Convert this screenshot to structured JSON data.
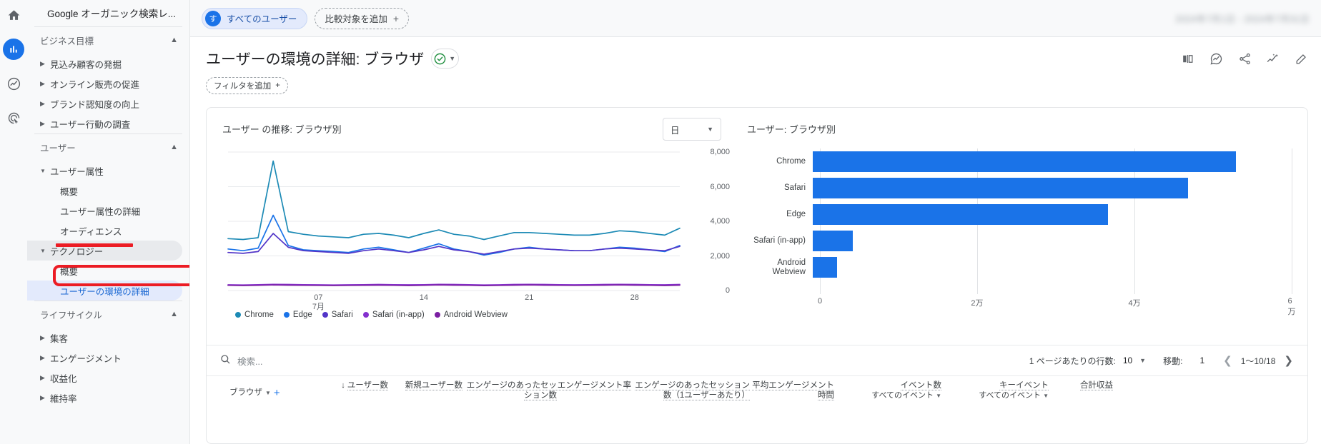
{
  "rail": {
    "items": [
      {
        "name": "home-icon",
        "label": "ホーム"
      },
      {
        "name": "reports-icon",
        "label": "レポート"
      },
      {
        "name": "explore-icon",
        "label": "探索"
      },
      {
        "name": "advertising-icon",
        "label": "広告"
      }
    ]
  },
  "sidebar": {
    "property_title": "Google オーガニック検索レ...",
    "groups": {
      "business": "ビジネス目標",
      "user": "ユーザー",
      "lifecycle": "ライフサイクル"
    },
    "items": [
      {
        "label": "見込み顧客の発掘",
        "marker": "collapsed"
      },
      {
        "label": "オンライン販売の促進",
        "marker": "collapsed"
      },
      {
        "label": "ブランド認知度の向上",
        "marker": "collapsed"
      },
      {
        "label": "ユーザー行動の調査",
        "marker": "collapsed"
      },
      {
        "label": "ユーザー属性",
        "marker": "expanded"
      },
      {
        "label": "概要",
        "marker": "none"
      },
      {
        "label": "ユーザー属性の詳細",
        "marker": "none"
      },
      {
        "label": "オーディエンス",
        "marker": "none"
      },
      {
        "label": "テクノロジー",
        "marker": "expanded"
      },
      {
        "label": "概要",
        "marker": "none"
      },
      {
        "label": "ユーザーの環境の詳細",
        "marker": "none"
      },
      {
        "label": "集客",
        "marker": "collapsed"
      },
      {
        "label": "エンゲージメント",
        "marker": "collapsed"
      },
      {
        "label": "収益化",
        "marker": "collapsed"
      },
      {
        "label": "維持率",
        "marker": "collapsed"
      }
    ]
  },
  "topbar": {
    "segment_chip": "すべてのユーザー",
    "segment_avatar_glyph": "す",
    "add_comparison": "比較対象を追加",
    "plus_glyph": "+",
    "date_range_blurred": "2024年7月1日 - 2024年7月31日"
  },
  "title": {
    "page_title": "ユーザーの環境の詳細: ブラウザ",
    "add_filter": "フィルタを追加",
    "icons": [
      {
        "name": "compare-icon"
      },
      {
        "name": "insights-icon"
      },
      {
        "name": "share-icon"
      },
      {
        "name": "trends-icon"
      },
      {
        "name": "edit-icon"
      }
    ]
  },
  "line_chart_card": {
    "title": "ユーザー の推移: ブラウザ別",
    "period_value": "日"
  },
  "bar_chart_card": {
    "title": "ユーザー: ブラウザ別"
  },
  "table": {
    "search_placeholder": "検索...",
    "rows_per_page_label": "1 ページあたりの行数:",
    "rows_per_page_value": "10",
    "goto_label": "移動:",
    "goto_value": "1",
    "range_label": "1～10/18",
    "columns": [
      {
        "name": "ブラウザ",
        "sub": ""
      },
      {
        "name": "ユーザー数",
        "sub": ""
      },
      {
        "name": "新規ユーザー数",
        "sub": ""
      },
      {
        "name": "エンゲージのあったセッション数",
        "sub": ""
      },
      {
        "name": "エンゲージメント率",
        "sub": ""
      },
      {
        "name": "エンゲージのあったセッション数（1ユーザーあたり）",
        "sub": ""
      },
      {
        "name": "平均エンゲージメント時間",
        "sub": ""
      },
      {
        "name": "イベント数",
        "sub": "すべてのイベント"
      },
      {
        "name": "キーイベント",
        "sub": "すべてのイベント"
      },
      {
        "name": "合計収益",
        "sub": ""
      }
    ]
  },
  "chart_data": [
    {
      "type": "line",
      "title": "ユーザー の推移: ブラウザ別",
      "xlabel": "",
      "ylabel": "",
      "ylim": [
        0,
        8000
      ],
      "yticks": [
        0,
        2000,
        4000,
        6000,
        8000
      ],
      "ytick_labels": [
        "0",
        "2,000",
        "4,000",
        "6,000",
        "8,000"
      ],
      "xticks": [
        "07",
        "14",
        "21",
        "28"
      ],
      "xtick_sub": "7月",
      "grid": true,
      "legend_position": "bottom",
      "series": [
        {
          "name": "Chrome",
          "color": "#1c8ab5",
          "values": [
            3000,
            2950,
            3050,
            7480,
            3400,
            3250,
            3150,
            3100,
            3050,
            3250,
            3300,
            3200,
            3050,
            3300,
            3500,
            3250,
            3150,
            2950,
            3150,
            3350,
            3350,
            3300,
            3250,
            3200,
            3200,
            3300,
            3450,
            3400,
            3300,
            3200,
            3600
          ]
        },
        {
          "name": "Edge",
          "color": "#1a73e8",
          "values": [
            2400,
            2300,
            2450,
            4350,
            2600,
            2350,
            2300,
            2250,
            2200,
            2400,
            2500,
            2350,
            2200,
            2450,
            2700,
            2400,
            2250,
            2050,
            2200,
            2400,
            2500,
            2400,
            2350,
            2300,
            2300,
            2400,
            2500,
            2450,
            2350,
            2250,
            2600
          ]
        },
        {
          "name": "Safari",
          "color": "#5235c8",
          "values": [
            2200,
            2150,
            2250,
            3300,
            2500,
            2300,
            2250,
            2200,
            2150,
            2300,
            2400,
            2300,
            2200,
            2350,
            2550,
            2350,
            2250,
            2100,
            2250,
            2400,
            2450,
            2400,
            2350,
            2300,
            2300,
            2400,
            2450,
            2400,
            2350,
            2300,
            2550
          ]
        },
        {
          "name": "Safari (in-app)",
          "color": "#8430ce",
          "values": [
            330,
            320,
            340,
            360,
            350,
            340,
            330,
            320,
            330,
            340,
            350,
            340,
            330,
            340,
            360,
            350,
            340,
            320,
            330,
            350,
            360,
            350,
            340,
            330,
            340,
            350,
            360,
            350,
            340,
            330,
            350
          ]
        },
        {
          "name": "Android Webview",
          "color": "#7b1fa2",
          "values": [
            300,
            290,
            300,
            320,
            310,
            300,
            295,
            290,
            295,
            305,
            310,
            300,
            290,
            300,
            320,
            310,
            300,
            285,
            295,
            310,
            320,
            310,
            300,
            295,
            300,
            310,
            320,
            310,
            300,
            290,
            310
          ]
        }
      ]
    },
    {
      "type": "bar",
      "orientation": "horizontal",
      "title": "ユーザー: ブラウザ別",
      "categories": [
        "Chrome",
        "Safari",
        "Edge",
        "Safari (in-app)",
        "Android Webview"
      ],
      "values": [
        53000,
        47000,
        37000,
        5000,
        3000
      ],
      "xlim": [
        0,
        60000
      ],
      "xticks": [
        0,
        20000,
        40000,
        60000
      ],
      "xtick_labels": [
        "0",
        "2万",
        "4万",
        "6万"
      ],
      "bar_color": "#1a73e8",
      "grid": true
    }
  ]
}
